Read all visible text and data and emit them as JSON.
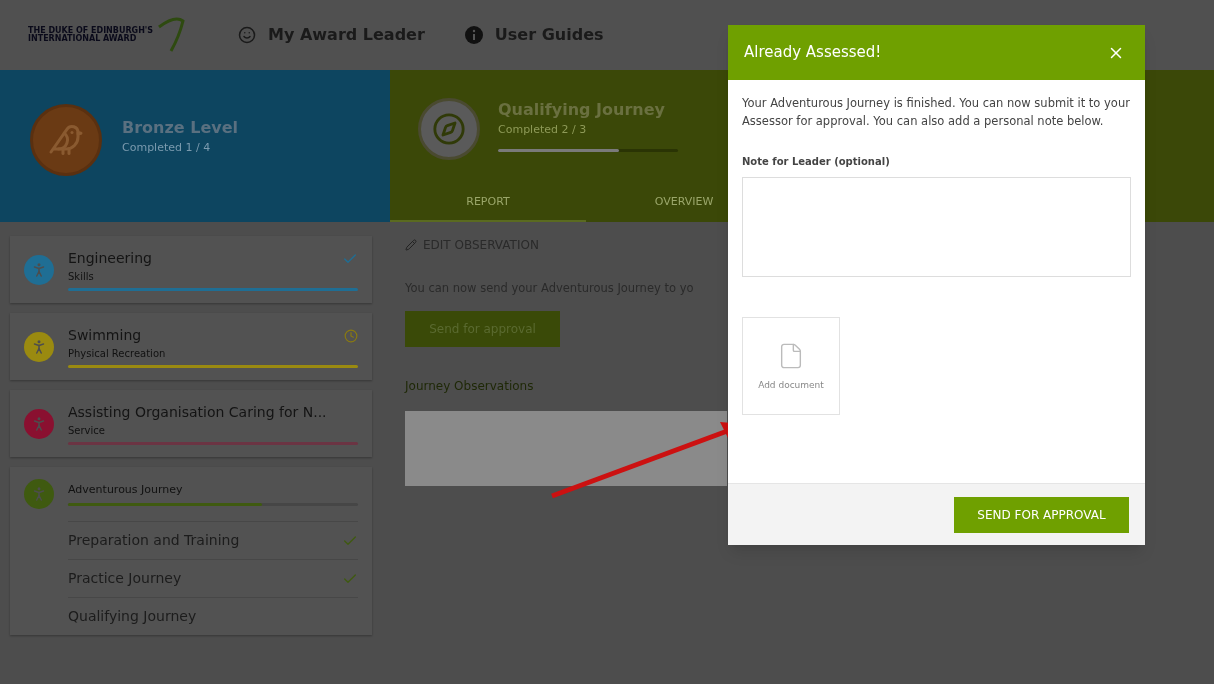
{
  "header": {
    "logo_lines": [
      "THE DUKE OF EDINBURGH'S",
      "INTERNATIONAL AWARD"
    ],
    "nav": [
      {
        "kind": "smile",
        "label": "My Award Leader"
      },
      {
        "kind": "info",
        "label": "User Guides"
      }
    ]
  },
  "level_card": {
    "title": "Bronze Level",
    "subtitle": "Completed 1 / 4"
  },
  "journey_card": {
    "title": "Qualifying Journey",
    "subtitle": "Completed 2 / 3",
    "level": 0.67,
    "tabs": [
      {
        "label": "REPORT",
        "selected": true
      },
      {
        "label": "OVERVIEW",
        "selected": false
      }
    ]
  },
  "sidebar": {
    "items": [
      {
        "title": "Engineering",
        "subtitle": "Skills",
        "color": "#1f6e94",
        "kind": "done"
      },
      {
        "title": "Swimming",
        "subtitle": "Physical Recreation",
        "color": "#9a8a10",
        "kind": "pending"
      },
      {
        "title": "Assisting Organisation Caring for N...",
        "subtitle": "Service",
        "color": "#8a1030",
        "kind": "plain"
      },
      {
        "title": "Adventurous Journey",
        "color": "#3f5a10",
        "kind": "progress",
        "level": 0.67,
        "children": [
          {
            "title": "Preparation and Training",
            "completed": true
          },
          {
            "title": "Practice Journey",
            "completed": true
          },
          {
            "title": "Qualifying Journey",
            "completed": false
          }
        ]
      }
    ]
  },
  "content": {
    "edit_link": "EDIT OBSERVATION",
    "message": "You can now send your Adventurous Journey to yo",
    "button": "Send for approval",
    "section_title": "Journey Observations"
  },
  "dialog": {
    "title": "Already Assessed!",
    "message": "Your Adventurous Journey is finished. You can now submit it to your Assessor for approval. You can also add a personal note below.",
    "note_label": "Note for Leader (optional)",
    "add_document": "Add document",
    "submit": "SEND FOR APPROVAL"
  }
}
